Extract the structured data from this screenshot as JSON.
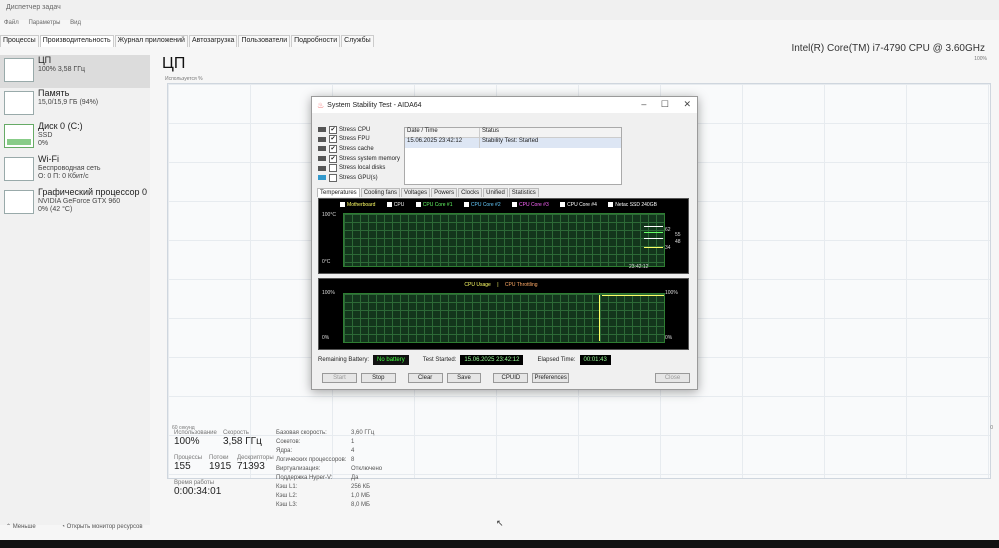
{
  "window": {
    "title": "Диспетчер задач",
    "menu": [
      "Файл",
      "Параметры",
      "Вид"
    ],
    "tabs": [
      "Процессы",
      "Производительность",
      "Журнал приложений",
      "Автозагрузка",
      "Пользователи",
      "Подробности",
      "Службы"
    ]
  },
  "sidebar": {
    "items": [
      {
        "title": "ЦП",
        "line1": "100% 3,58 ГГц",
        "line2": ""
      },
      {
        "title": "Память",
        "line1": "15,0/15,9 ГБ (94%)",
        "line2": ""
      },
      {
        "title": "Диск 0 (C:)",
        "line1": "SSD",
        "line2": "0%"
      },
      {
        "title": "Wi-Fi",
        "line1": "Беспроводная сеть",
        "line2": "О: 0 П: 0 Кбит/с"
      },
      {
        "title": "Графический процессор 0",
        "line1": "NVIDIA GeForce GTX 960",
        "line2": "0% (42 °C)"
      }
    ]
  },
  "main": {
    "title": "ЦП",
    "cpu_model": "Intel(R) Core(TM) i7-4790 CPU @ 3.60GHz",
    "used_label": "Используется %",
    "max_label": "100%",
    "graph_left_label": "60 секунд",
    "graph_right_label": "0",
    "utilization_label": "Использование",
    "utilization_value": "100%",
    "speed_label": "Скорость",
    "speed_value": "3,58 ГГц",
    "processes_label": "Процессы",
    "processes_value": "155",
    "threads_label": "Потоки",
    "threads_value": "1915",
    "handles_label": "Дескрипторы",
    "handles_value": "71393",
    "uptime_label": "Время работы",
    "uptime_value": "0:00:34:01",
    "info": [
      {
        "k": "Базовая скорость:",
        "v": "3,60 ГГц"
      },
      {
        "k": "Сокетов:",
        "v": "1"
      },
      {
        "k": "Ядра:",
        "v": "4"
      },
      {
        "k": "Логических процессоров:",
        "v": "8"
      },
      {
        "k": "Виртуализация:",
        "v": "Отключено"
      },
      {
        "k": "Поддержка Hyper-V:",
        "v": "Да"
      },
      {
        "k": "Кэш L1:",
        "v": "256 КБ"
      },
      {
        "k": "Кэш L2:",
        "v": "1,0 МБ"
      },
      {
        "k": "Кэш L3:",
        "v": "8,0 МБ"
      }
    ]
  },
  "footer": {
    "less": "Меньше",
    "monitor": "Открыть монитор ресурсов"
  },
  "dialog": {
    "title": "System Stability Test - AIDA64",
    "stress": [
      {
        "label": "Stress CPU",
        "checked": "✔"
      },
      {
        "label": "Stress FPU",
        "checked": "✔"
      },
      {
        "label": "Stress cache",
        "checked": "✔"
      },
      {
        "label": "Stress system memory",
        "checked": "✔"
      },
      {
        "label": "Stress local disks",
        "checked": ""
      },
      {
        "label": "Stress GPU(s)",
        "checked": ""
      }
    ],
    "log_headers": [
      "Date / Time",
      "Status"
    ],
    "log_row": [
      "15.06.2025 23:42:12",
      "Stability Test: Started"
    ],
    "tabs": [
      "Temperatures",
      "Cooling fans",
      "Voltages",
      "Powers",
      "Clocks",
      "Unified",
      "Statistics"
    ],
    "temp_legend": [
      "Motherboard",
      "CPU",
      "CPU Core #1",
      "CPU Core #2",
      "CPU Core #3",
      "CPU Core #4",
      "Netac SSD 240GB"
    ],
    "temp_colors": [
      "#ffff66",
      "#ffffff",
      "#66ff66",
      "#66ccff",
      "#ff66ff",
      "#ffffff",
      "#ffffff"
    ],
    "temp_top": "100°C",
    "temp_bottom": "0°C",
    "temp_time": "23:42:12",
    "temp_values": [
      "62",
      "55",
      "48",
      "34"
    ],
    "usage_legend_a": "CPU Usage",
    "usage_sep": "|",
    "usage_legend_b": "CPU Throttling",
    "usage_top": "100%",
    "usage_bottom": "0%",
    "usage_right_top": "100%",
    "usage_right_bottom": "0%",
    "battery_label": "Remaining Battery:",
    "battery_value": "No battery",
    "started_label": "Test Started:",
    "started_value": "15.06.2025 23:42:12",
    "elapsed_label": "Elapsed Time:",
    "elapsed_value": "00:01:43",
    "buttons": [
      "Start",
      "Stop",
      "Clear",
      "Save",
      "CPUID",
      "Preferences",
      "Close"
    ]
  }
}
